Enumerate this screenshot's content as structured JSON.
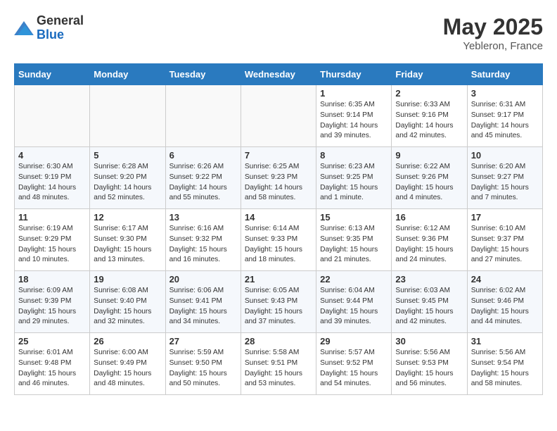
{
  "header": {
    "logo_general": "General",
    "logo_blue": "Blue",
    "month_year": "May 2025",
    "location": "Yebleron, France"
  },
  "days_of_week": [
    "Sunday",
    "Monday",
    "Tuesday",
    "Wednesday",
    "Thursday",
    "Friday",
    "Saturday"
  ],
  "weeks": [
    [
      {
        "day": "",
        "content": ""
      },
      {
        "day": "",
        "content": ""
      },
      {
        "day": "",
        "content": ""
      },
      {
        "day": "",
        "content": ""
      },
      {
        "day": "1",
        "content": "Sunrise: 6:35 AM\nSunset: 9:14 PM\nDaylight: 14 hours\nand 39 minutes."
      },
      {
        "day": "2",
        "content": "Sunrise: 6:33 AM\nSunset: 9:16 PM\nDaylight: 14 hours\nand 42 minutes."
      },
      {
        "day": "3",
        "content": "Sunrise: 6:31 AM\nSunset: 9:17 PM\nDaylight: 14 hours\nand 45 minutes."
      }
    ],
    [
      {
        "day": "4",
        "content": "Sunrise: 6:30 AM\nSunset: 9:19 PM\nDaylight: 14 hours\nand 48 minutes."
      },
      {
        "day": "5",
        "content": "Sunrise: 6:28 AM\nSunset: 9:20 PM\nDaylight: 14 hours\nand 52 minutes."
      },
      {
        "day": "6",
        "content": "Sunrise: 6:26 AM\nSunset: 9:22 PM\nDaylight: 14 hours\nand 55 minutes."
      },
      {
        "day": "7",
        "content": "Sunrise: 6:25 AM\nSunset: 9:23 PM\nDaylight: 14 hours\nand 58 minutes."
      },
      {
        "day": "8",
        "content": "Sunrise: 6:23 AM\nSunset: 9:25 PM\nDaylight: 15 hours\nand 1 minute."
      },
      {
        "day": "9",
        "content": "Sunrise: 6:22 AM\nSunset: 9:26 PM\nDaylight: 15 hours\nand 4 minutes."
      },
      {
        "day": "10",
        "content": "Sunrise: 6:20 AM\nSunset: 9:27 PM\nDaylight: 15 hours\nand 7 minutes."
      }
    ],
    [
      {
        "day": "11",
        "content": "Sunrise: 6:19 AM\nSunset: 9:29 PM\nDaylight: 15 hours\nand 10 minutes."
      },
      {
        "day": "12",
        "content": "Sunrise: 6:17 AM\nSunset: 9:30 PM\nDaylight: 15 hours\nand 13 minutes."
      },
      {
        "day": "13",
        "content": "Sunrise: 6:16 AM\nSunset: 9:32 PM\nDaylight: 15 hours\nand 16 minutes."
      },
      {
        "day": "14",
        "content": "Sunrise: 6:14 AM\nSunset: 9:33 PM\nDaylight: 15 hours\nand 18 minutes."
      },
      {
        "day": "15",
        "content": "Sunrise: 6:13 AM\nSunset: 9:35 PM\nDaylight: 15 hours\nand 21 minutes."
      },
      {
        "day": "16",
        "content": "Sunrise: 6:12 AM\nSunset: 9:36 PM\nDaylight: 15 hours\nand 24 minutes."
      },
      {
        "day": "17",
        "content": "Sunrise: 6:10 AM\nSunset: 9:37 PM\nDaylight: 15 hours\nand 27 minutes."
      }
    ],
    [
      {
        "day": "18",
        "content": "Sunrise: 6:09 AM\nSunset: 9:39 PM\nDaylight: 15 hours\nand 29 minutes."
      },
      {
        "day": "19",
        "content": "Sunrise: 6:08 AM\nSunset: 9:40 PM\nDaylight: 15 hours\nand 32 minutes."
      },
      {
        "day": "20",
        "content": "Sunrise: 6:06 AM\nSunset: 9:41 PM\nDaylight: 15 hours\nand 34 minutes."
      },
      {
        "day": "21",
        "content": "Sunrise: 6:05 AM\nSunset: 9:43 PM\nDaylight: 15 hours\nand 37 minutes."
      },
      {
        "day": "22",
        "content": "Sunrise: 6:04 AM\nSunset: 9:44 PM\nDaylight: 15 hours\nand 39 minutes."
      },
      {
        "day": "23",
        "content": "Sunrise: 6:03 AM\nSunset: 9:45 PM\nDaylight: 15 hours\nand 42 minutes."
      },
      {
        "day": "24",
        "content": "Sunrise: 6:02 AM\nSunset: 9:46 PM\nDaylight: 15 hours\nand 44 minutes."
      }
    ],
    [
      {
        "day": "25",
        "content": "Sunrise: 6:01 AM\nSunset: 9:48 PM\nDaylight: 15 hours\nand 46 minutes."
      },
      {
        "day": "26",
        "content": "Sunrise: 6:00 AM\nSunset: 9:49 PM\nDaylight: 15 hours\nand 48 minutes."
      },
      {
        "day": "27",
        "content": "Sunrise: 5:59 AM\nSunset: 9:50 PM\nDaylight: 15 hours\nand 50 minutes."
      },
      {
        "day": "28",
        "content": "Sunrise: 5:58 AM\nSunset: 9:51 PM\nDaylight: 15 hours\nand 53 minutes."
      },
      {
        "day": "29",
        "content": "Sunrise: 5:57 AM\nSunset: 9:52 PM\nDaylight: 15 hours\nand 54 minutes."
      },
      {
        "day": "30",
        "content": "Sunrise: 5:56 AM\nSunset: 9:53 PM\nDaylight: 15 hours\nand 56 minutes."
      },
      {
        "day": "31",
        "content": "Sunrise: 5:56 AM\nSunset: 9:54 PM\nDaylight: 15 hours\nand 58 minutes."
      }
    ]
  ]
}
